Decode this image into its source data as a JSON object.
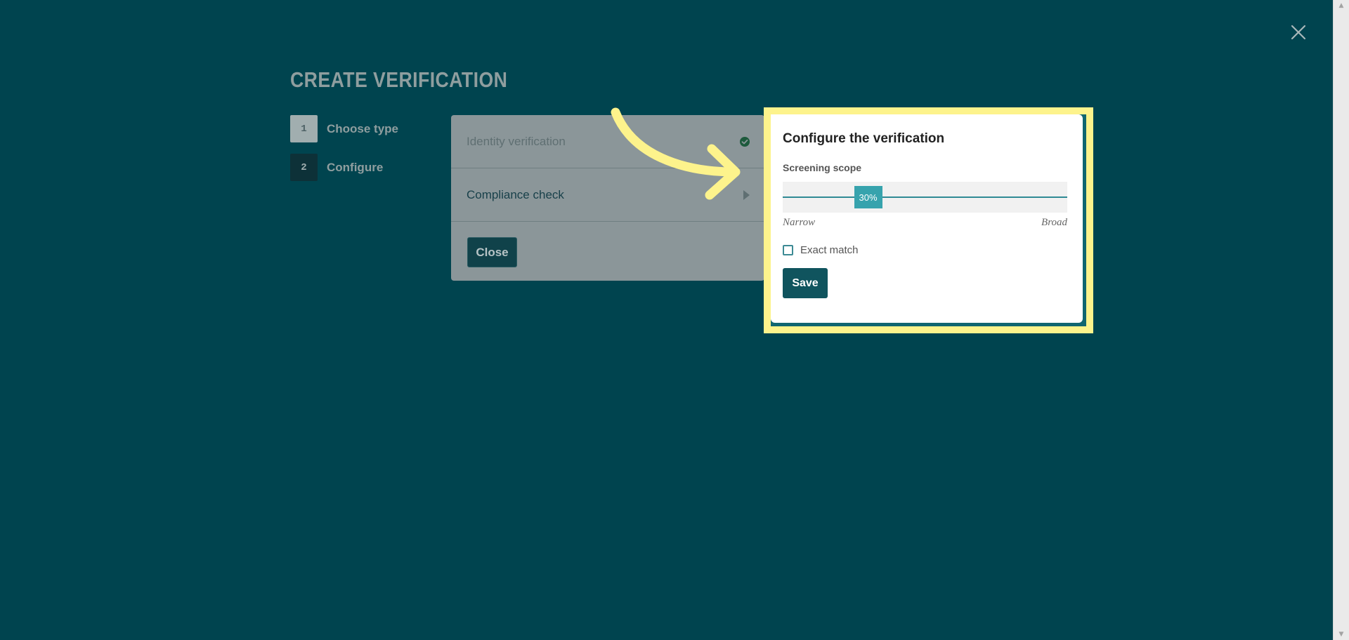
{
  "page": {
    "title": "CREATE VERIFICATION"
  },
  "steps": [
    {
      "number": "1",
      "label": "Choose type"
    },
    {
      "number": "2",
      "label": "Configure"
    }
  ],
  "options": {
    "items": [
      {
        "label": "Identity verification",
        "status": "check-circle-icon"
      },
      {
        "label": "Compliance check",
        "status": "triangle-right-icon"
      }
    ],
    "close_label": "Close"
  },
  "config": {
    "title": "Configure the verification",
    "scope_label": "Screening scope",
    "scope_value_text": "30%",
    "scope_value_percent": 30,
    "scope_min_label": "Narrow",
    "scope_max_label": "Broad",
    "exact_match_label": "Exact match",
    "exact_match_checked": false,
    "save_label": "Save"
  },
  "colors": {
    "backdrop": "#00444f",
    "highlight": "#fdf38c",
    "accent": "#37a3ad",
    "primary_button": "#10545e"
  }
}
